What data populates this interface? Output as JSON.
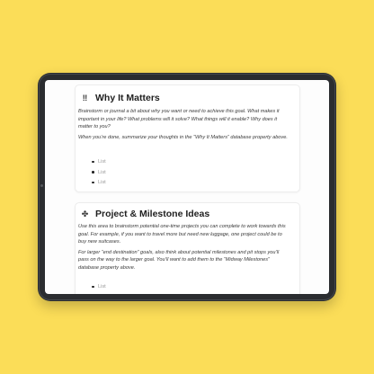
{
  "sections": [
    {
      "icon": "‼",
      "icon_name": "double-exclamation-icon",
      "title": "Why It Matters",
      "paragraphs": [
        "Brainstorm or journal a bit about why you want or need to achieve this goal. What makes it important in your life? What problems will it solve? What things will it enable? Why does it matter to you?",
        "When you’re done, summarize your thoughts in the “Why It Matters” database property above."
      ],
      "list_items": [
        "List",
        "List",
        "List"
      ]
    },
    {
      "icon": "✤",
      "icon_name": "nodes-icon",
      "title": "Project & Milestone Ideas",
      "paragraphs": [
        "Use this area to brainstorm potential one-time projects you can complete to work towards this goal. For example, if you want to travel more but need new luggage, one project could be to buy new suitcases.",
        "For larger “end destination” goals, also think about potential milestones and pit stops you’ll pass on the way to the larger goal. You’ll want to add them to the “Midway Milestones” database property above."
      ],
      "list_items": [
        "List"
      ]
    }
  ]
}
